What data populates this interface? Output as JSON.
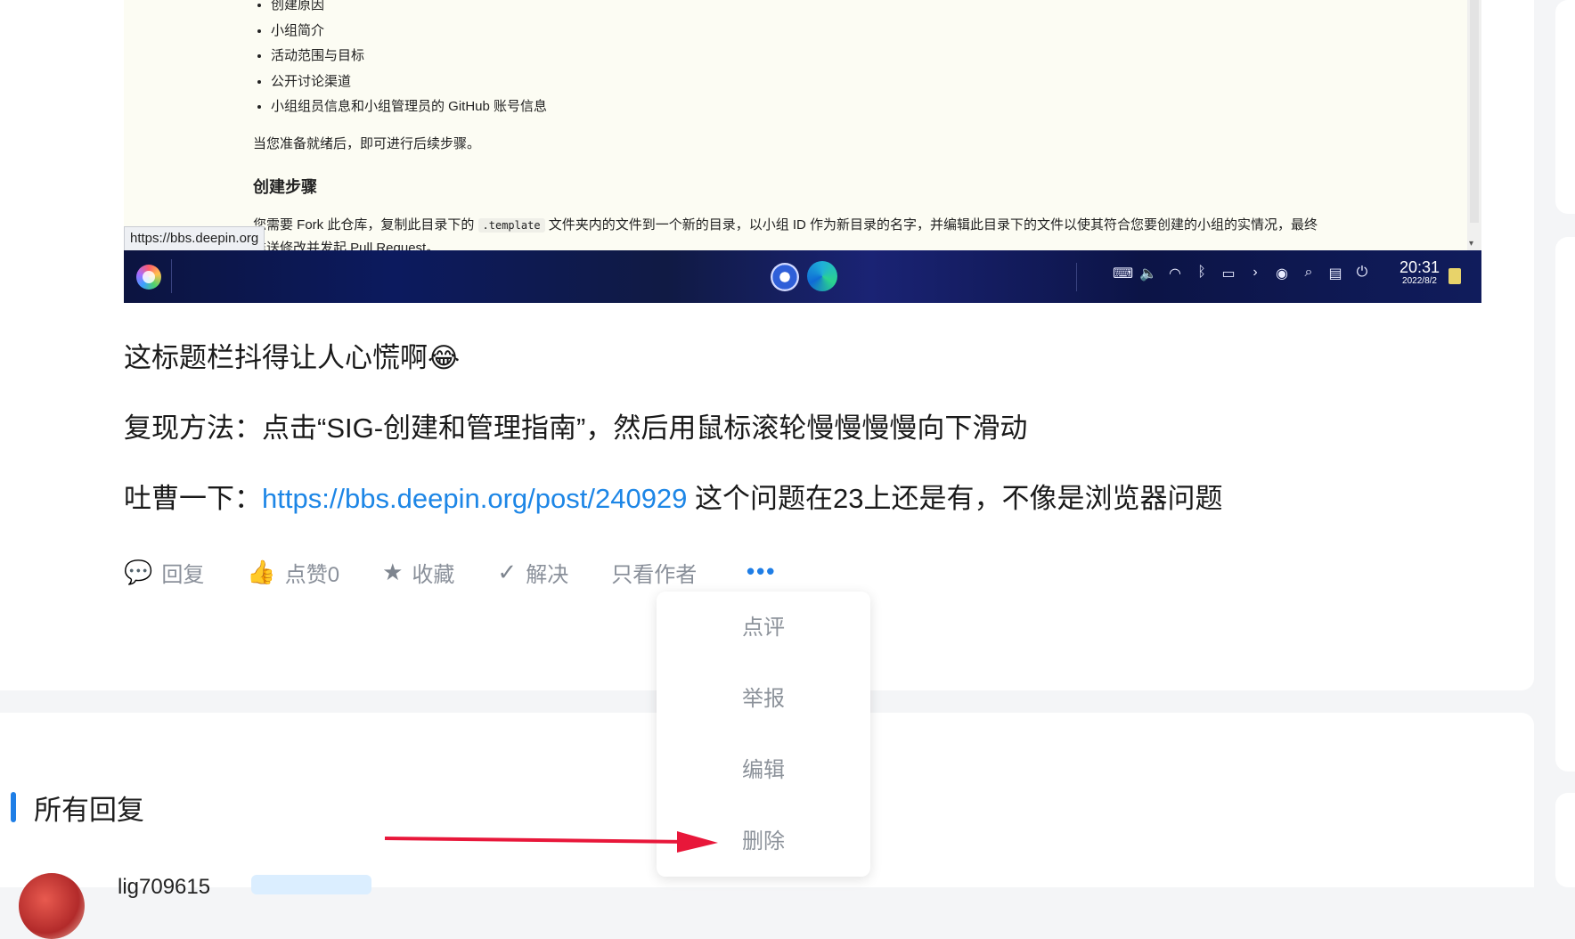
{
  "screenshot": {
    "doc_list": [
      "创建原因",
      "小组简介",
      "活动范围与目标",
      "公开讨论渠道",
      "小组组员信息和小组管理员的 GitHub 账号信息"
    ],
    "doc_paragraph": "当您准备就绪后，即可进行后续步骤。",
    "doc_heading": "创建步骤",
    "doc_long_before": "您需要 Fork 此仓库，复制此目录下的",
    "doc_long_code": ".template",
    "doc_long_after": "文件夹内的文件到一个新的目录，以小组 ID 作为新目录的名字，并编辑此目录下的文件以使其符合您要创建的小组的实情况，最终推送修改并发起 Pull Request。",
    "status_url": "https://bbs.deepin.org",
    "taskbar": {
      "time": "20:31",
      "date": "2022/8/2",
      "tray_icons": [
        "keyboard-icon",
        "volume-icon",
        "wifi-icon",
        "bluetooth-icon",
        "battery-icon",
        "chevron-right-icon",
        "monitor-icon",
        "search-icon",
        "notification-icon",
        "power-icon"
      ]
    }
  },
  "post": {
    "line1": "这标题栏抖得让人心慌啊😂",
    "line2": "复现方法：点击“SIG-创建和管理指南”，然后用鼠标滚轮慢慢慢慢向下滑动",
    "line3_prefix": "吐曹一下：",
    "line3_link": "https://bbs.deepin.org/post/240929",
    "line3_suffix": " 这个问题在23上还是有，不像是浏览器问题"
  },
  "actions": {
    "reply": "回复",
    "like": "点赞0",
    "favorite": "收藏",
    "solve": "解决",
    "author_only": "只看作者",
    "more": "•••"
  },
  "dropdown": {
    "items": [
      "点评",
      "举报",
      "编辑",
      "删除"
    ]
  },
  "replies": {
    "title": "所有回复",
    "first_user": "lig709615"
  },
  "colors": {
    "accent": "#1f7ee6",
    "link": "#1d86e6",
    "annotation_arrow": "#e8173a"
  }
}
